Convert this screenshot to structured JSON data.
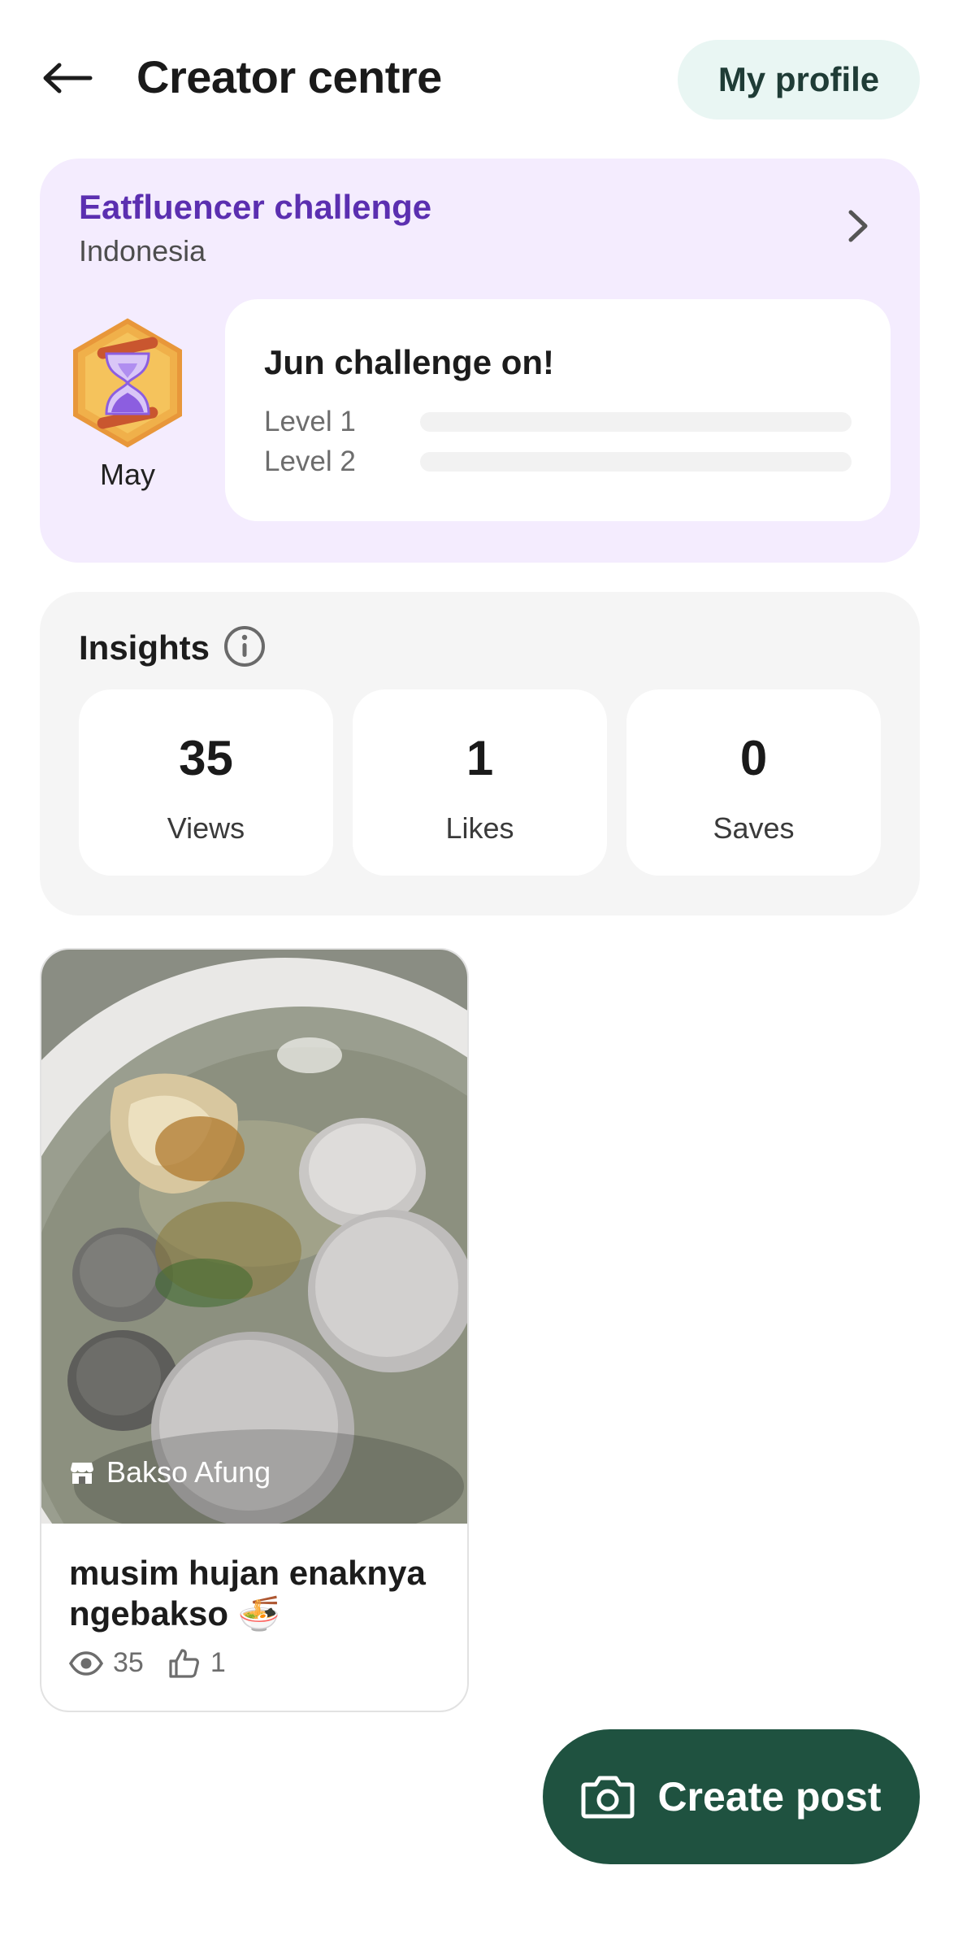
{
  "header": {
    "title": "Creator centre",
    "back_icon": "arrow-left-icon",
    "profile_button": "My profile"
  },
  "challenge": {
    "title": "Eatfluencer challenge",
    "region": "Indonesia",
    "badge_icon": "hourglass-badge-icon",
    "badge_label": "May",
    "card_title": "Jun challenge on!",
    "levels": [
      {
        "label": "Level 1",
        "progress": 0
      },
      {
        "label": "Level 2",
        "progress": 0
      }
    ]
  },
  "insights": {
    "title": "Insights",
    "stats": [
      {
        "value": "35",
        "label": "Views"
      },
      {
        "value": "1",
        "label": "Likes"
      },
      {
        "value": "0",
        "label": "Saves"
      }
    ]
  },
  "post": {
    "place": "Bakso Afung",
    "title": "musim hujan enaknya ngebakso 🍜",
    "views": "35",
    "likes": "1"
  },
  "create_button": "Create post",
  "colors": {
    "accent_dark_green": "#1f5240",
    "challenge_purple": "#5b2fb0",
    "challenge_bg": "#f4ecfe",
    "profile_bg": "#e9f6f3"
  }
}
